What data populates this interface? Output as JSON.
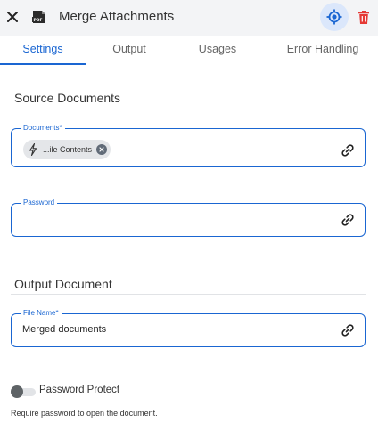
{
  "header": {
    "close_icon": "close-icon",
    "file_icon": "pdf-file-icon",
    "file_icon_label": "PDF",
    "title": "Merge Attachments",
    "locate_icon": "crosshair-icon",
    "delete_icon": "trash-icon"
  },
  "tabs": [
    {
      "label": "Settings",
      "active": true
    },
    {
      "label": "Output",
      "active": false
    },
    {
      "label": "Usages",
      "active": false
    },
    {
      "label": "Error Handling",
      "active": false
    }
  ],
  "source": {
    "title": "Source Documents",
    "documents": {
      "label": "Documents*",
      "chip_text": "...ile Contents",
      "chip_icon": "lightning-bolt-icon",
      "link_icon": "link-icon"
    },
    "password": {
      "label": "Password",
      "value": "",
      "link_icon": "link-icon"
    }
  },
  "output": {
    "title": "Output Document",
    "file_name": {
      "label": "File Name*",
      "value": "Merged documents",
      "link_icon": "link-icon"
    },
    "password_protect": {
      "label": "Password Protect",
      "enabled": false,
      "helper": "Require password to open the document."
    }
  },
  "colors": {
    "accent": "#1a66d2",
    "danger": "#e53935",
    "header_bg": "#f3f4f6"
  }
}
